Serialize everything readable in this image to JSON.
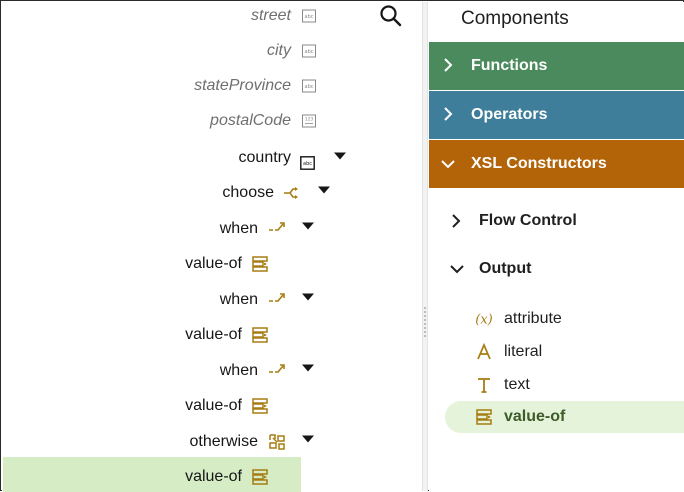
{
  "tree": {
    "source_fields": [
      {
        "label": "street",
        "icon": "string-icon"
      },
      {
        "label": "city",
        "icon": "string-icon"
      },
      {
        "label": "stateProvince",
        "icon": "string-icon"
      },
      {
        "label": "postalCode",
        "icon": "number-icon"
      }
    ],
    "target_nodes": [
      {
        "label": "country",
        "icon": "string-icon"
      },
      {
        "label": "choose",
        "icon": "choose-icon"
      },
      {
        "label": "when",
        "icon": "when-icon"
      },
      {
        "label": "value-of",
        "icon": "value-of-icon"
      },
      {
        "label": "when",
        "icon": "when-icon"
      },
      {
        "label": "value-of",
        "icon": "value-of-icon"
      },
      {
        "label": "when",
        "icon": "when-icon"
      },
      {
        "label": "value-of",
        "icon": "value-of-icon"
      },
      {
        "label": "otherwise",
        "icon": "otherwise-icon"
      },
      {
        "label": "value-of",
        "icon": "value-of-icon"
      }
    ],
    "selected_node": "value-of"
  },
  "components": {
    "title": "Components",
    "categories": [
      {
        "label": "Functions",
        "color": "#4b8a5c",
        "expanded": false
      },
      {
        "label": "Operators",
        "color": "#3f7e9a",
        "expanded": false
      },
      {
        "label": "XSL Constructors",
        "color": "#b36308",
        "expanded": true
      }
    ],
    "groups": [
      {
        "label": "Flow Control",
        "expanded": false
      },
      {
        "label": "Output",
        "expanded": true
      }
    ],
    "output_items": [
      {
        "label": "attribute",
        "icon": "attribute-icon"
      },
      {
        "label": "literal",
        "icon": "literal-icon"
      },
      {
        "label": "text",
        "icon": "text-icon"
      },
      {
        "label": "value-of",
        "icon": "value-of-icon",
        "selected": true
      }
    ]
  },
  "colors": {
    "icon_gold": "#a77d12",
    "selected_row_bg": "#d5ecc5",
    "selected_item_bg": "#e4f3da"
  }
}
